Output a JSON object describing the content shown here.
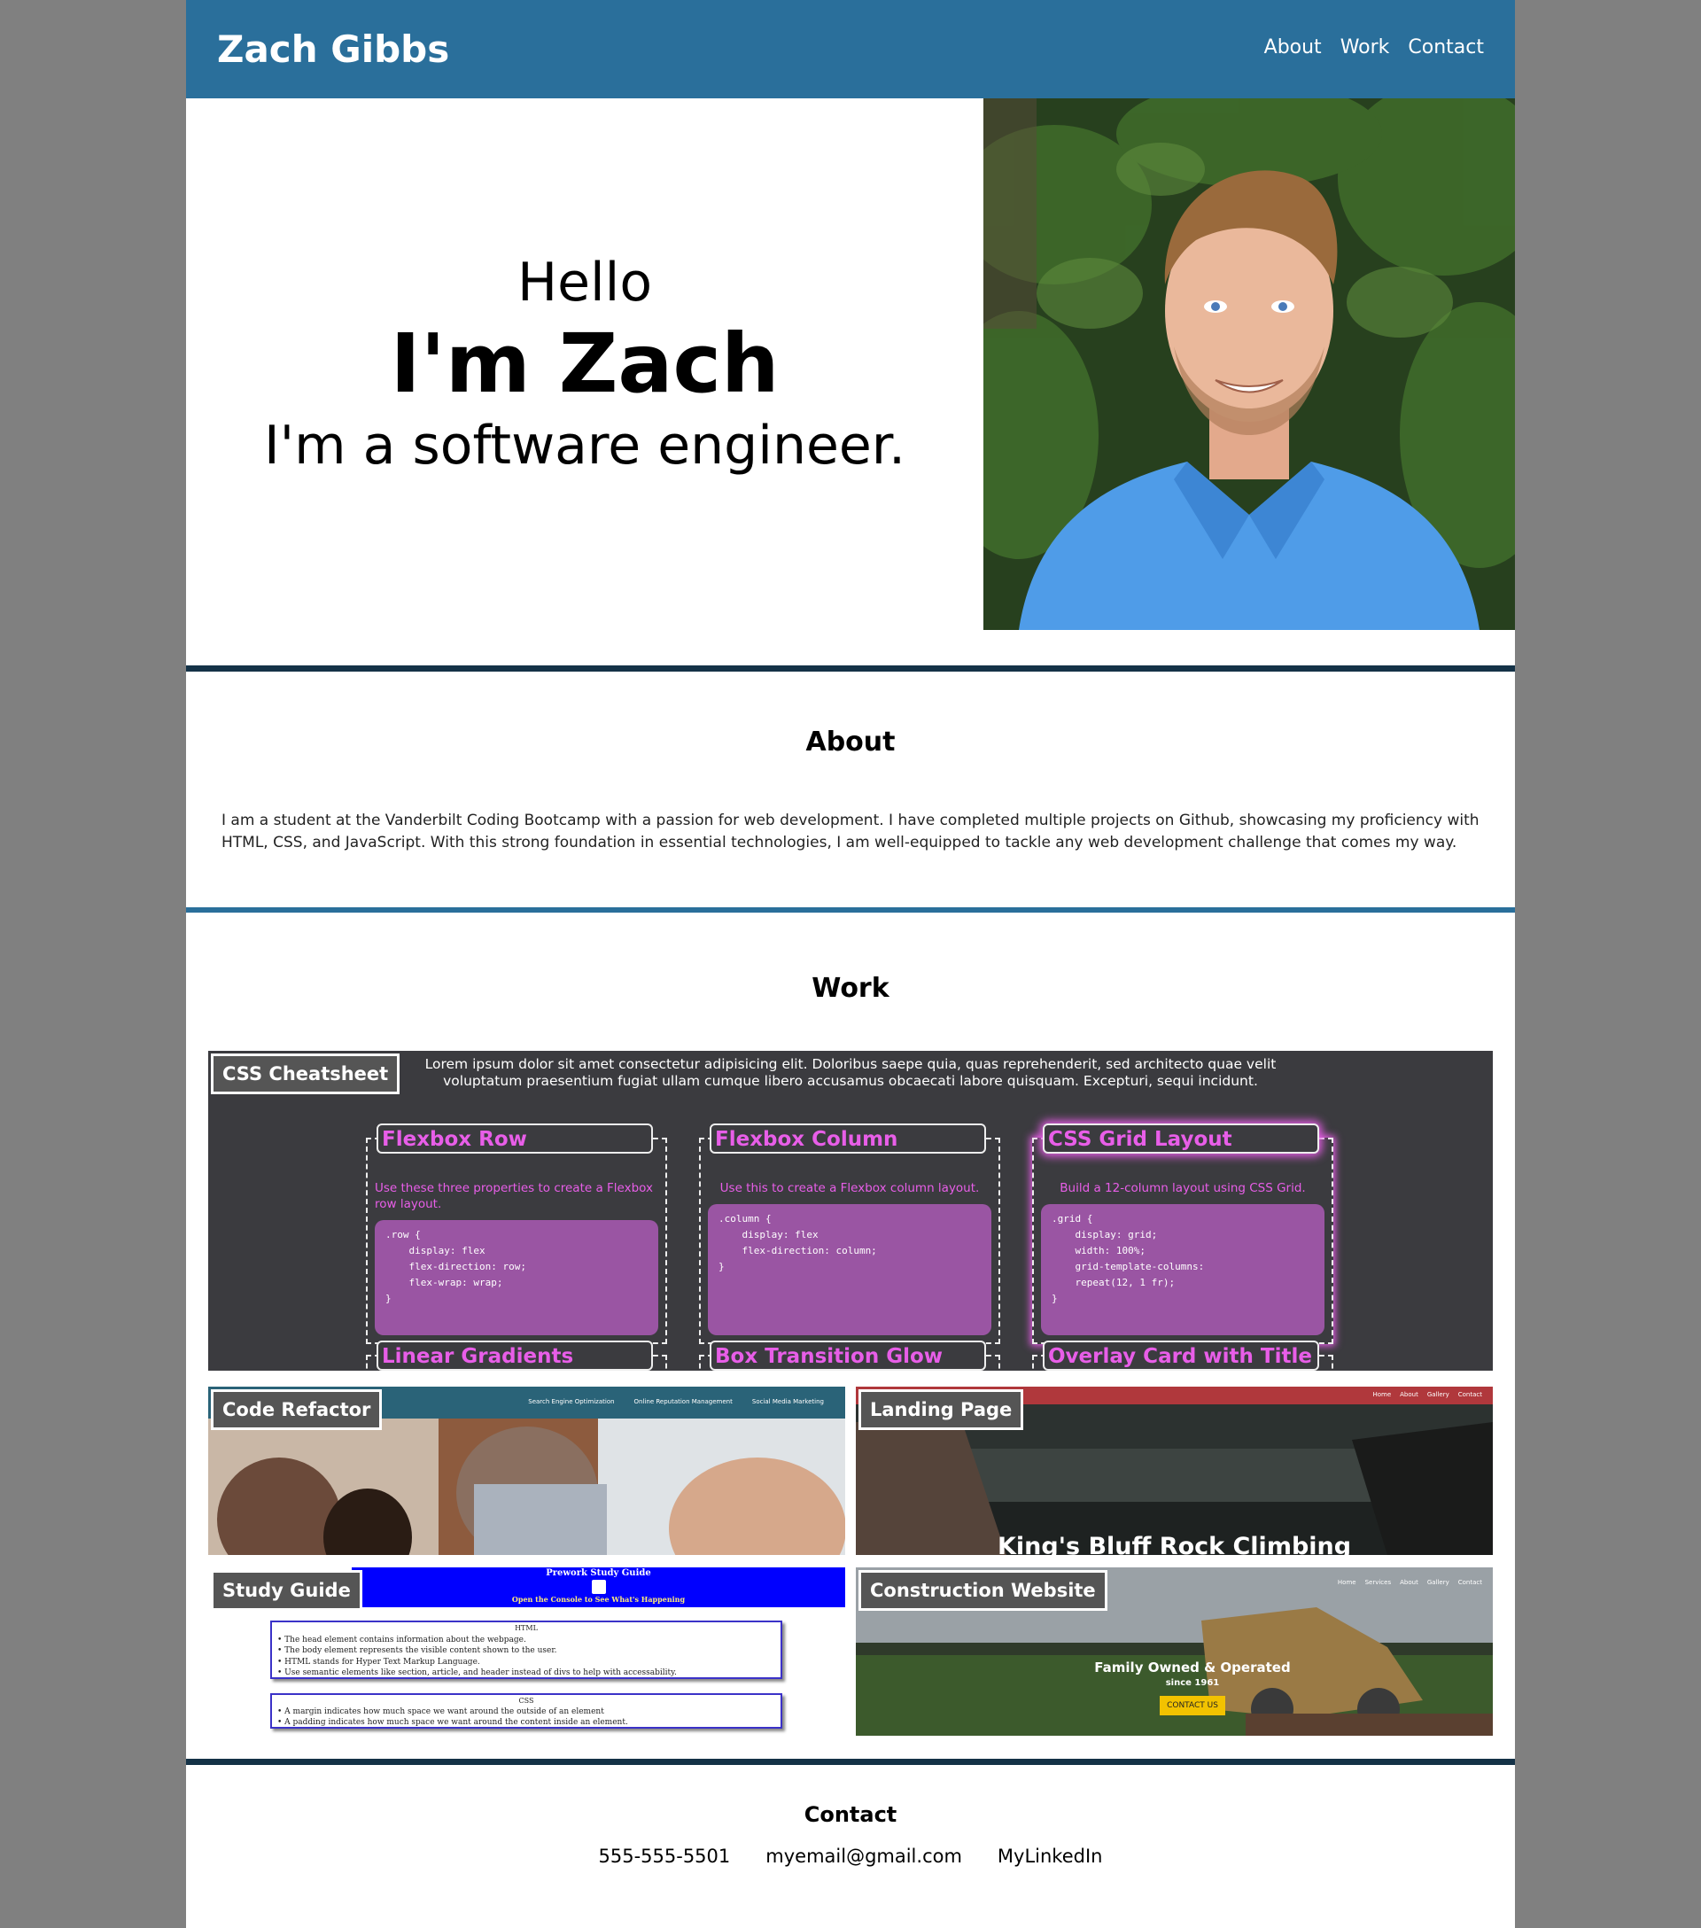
{
  "header": {
    "title": "Zach Gibbs",
    "nav": [
      "About",
      "Work",
      "Contact"
    ]
  },
  "hero": {
    "hello": "Hello",
    "name": "I'm Zach",
    "role": "I'm a software engineer."
  },
  "about": {
    "title": "About",
    "text": "I am a student at the Vanderbilt Coding Bootcamp with a passion for web development. I have completed multiple projects on Github, showcasing my proficiency with HTML, CSS, and JavaScript. With this strong foundation in essential technologies, I am well-equipped to tackle any web development challenge that comes my way."
  },
  "work": {
    "title": "Work",
    "projects": [
      {
        "label": "CSS Cheatsheet"
      },
      {
        "label": "Code Refactor"
      },
      {
        "label": "Landing Page"
      },
      {
        "label": "Study Guide"
      },
      {
        "label": "Construction Website"
      }
    ],
    "cheatsheet_preview": {
      "lorem": "Lorem ipsum dolor sit amet consectetur adipisicing elit. Doloribus saepe quia, quas reprehenderit, sed architecto quae velit voluptatum praesentium fugiat ullam cumque libero accusamus obcaecati labore quisquam. Excepturi, sequi incidunt.",
      "cards": [
        {
          "title": "Flexbox Row",
          "desc": "Use these three properties to create a Flexbox row layout.",
          "code": ".row {\n    display: flex\n    flex-direction: row;\n    flex-wrap: wrap;\n}"
        },
        {
          "title": "Flexbox Column",
          "desc": "Use this to create a Flexbox column layout.",
          "code": ".column {\n    display: flex\n    flex-direction: column;\n}"
        },
        {
          "title": "CSS Grid Layout",
          "desc": "Build a 12-column layout using CSS Grid.",
          "code": ".grid {\n    display: grid;\n    width: 100%;\n    grid-template-columns:\n    repeat(12, 1 fr);\n}"
        }
      ],
      "cards_row2": [
        "Linear Gradients",
        "Box Transition Glow",
        "Overlay Card with Title"
      ]
    },
    "code_refactor_preview": {
      "nav": [
        "Search Engine Optimization",
        "Online Reputation Management",
        "Social Media Marketing"
      ]
    },
    "landing_preview": {
      "nav": [
        "Home",
        "About",
        "Gallery",
        "Contact"
      ],
      "headline": "King's Bluff Rock Climbing"
    },
    "study_preview": {
      "title": "Prework Study Guide",
      "subtitle": "Open the Console to See What's Happening",
      "html_heading": "HTML",
      "html_items": [
        "The head element contains information about the webpage.",
        "The body element represents the visible content shown to the user.",
        "HTML stands for Hyper Text Markup Language.",
        "Use semantic elements like section, article, and header instead of divs to help with accessability."
      ],
      "css_heading": "CSS",
      "css_items": [
        "A margin indicates how much space we want around the outside of an element",
        "A padding indicates how much space we want around the content inside an element."
      ]
    },
    "construction_preview": {
      "nav": [
        "Home",
        "Services",
        "About",
        "Gallery",
        "Contact"
      ],
      "headline": "Family Owned & Operated",
      "since": "since 1961",
      "cta": "CONTACT US"
    }
  },
  "contact": {
    "title": "Contact",
    "phone": "555-555-5501",
    "email": "myemail@gmail.com",
    "linkedin": "MyLinkedIn"
  },
  "colors": {
    "header_bg": "#2a6f9b",
    "divider_dark": "#143247",
    "page_bg": "#808080",
    "accent_pink": "#e85ee8"
  }
}
